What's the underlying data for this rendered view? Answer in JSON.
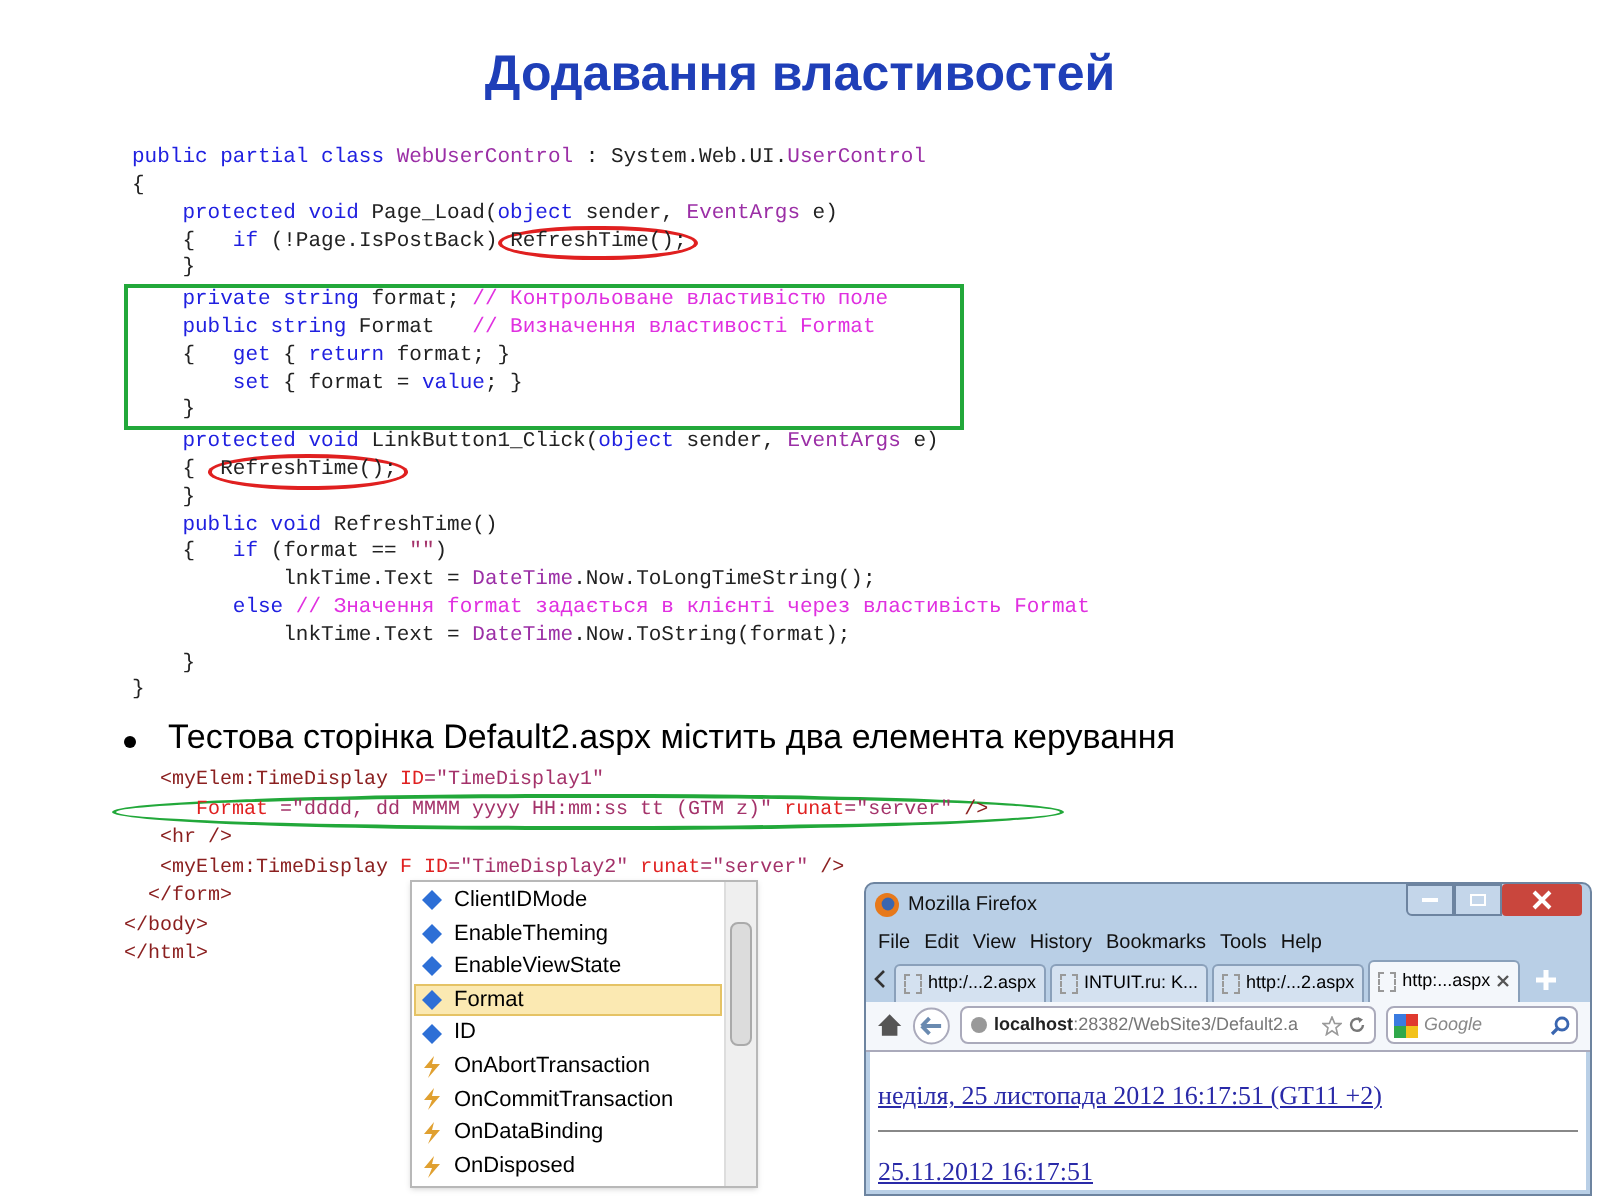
{
  "title": "Додавання властивостей",
  "code_blocks": [
    {
      "boxed": false,
      "lines": [
        [
          {
            "text": "public partial class ",
            "kind": "keyword"
          },
          {
            "text": "WebUserControl",
            "kind": "type"
          },
          {
            "text": " : System.Web.UI.",
            "kind": "plain"
          },
          {
            "text": "UserControl",
            "kind": "type"
          }
        ],
        [
          {
            "text": "{",
            "kind": "plain"
          }
        ],
        [
          {
            "text": "    protected void ",
            "kind": "keyword"
          },
          {
            "text": "Page_Load(",
            "kind": "plain"
          },
          {
            "text": "object",
            "kind": "keyword"
          },
          {
            "text": " sender, ",
            "kind": "plain"
          },
          {
            "text": "EventArgs",
            "kind": "type"
          },
          {
            "text": " e)",
            "kind": "plain"
          }
        ],
        [
          {
            "text": "    {   ",
            "kind": "plain"
          },
          {
            "text": "if",
            "kind": "keyword"
          },
          {
            "text": " (!Page.IsPostBack) ",
            "kind": "plain"
          },
          {
            "text": "RefreshTime();",
            "kind": "circled"
          }
        ],
        [
          {
            "text": "    }",
            "kind": "plain"
          }
        ]
      ]
    },
    {
      "boxed": true,
      "lines": [
        [
          {
            "text": "    private string ",
            "kind": "keyword"
          },
          {
            "text": "format; ",
            "kind": "plain"
          },
          {
            "text": "// Контрольоване властивістю поле",
            "kind": "comment"
          }
        ],
        [
          {
            "text": "    public string ",
            "kind": "keyword"
          },
          {
            "text": "Format   ",
            "kind": "plain"
          },
          {
            "text": "// Визначення властивості Format",
            "kind": "comment"
          }
        ],
        [
          {
            "text": "    {   ",
            "kind": "plain"
          },
          {
            "text": "get",
            "kind": "keyword"
          },
          {
            "text": " { ",
            "kind": "plain"
          },
          {
            "text": "return",
            "kind": "keyword"
          },
          {
            "text": " format; }",
            "kind": "plain"
          }
        ],
        [
          {
            "text": "        set",
            "kind": "keyword"
          },
          {
            "text": " { format = ",
            "kind": "plain"
          },
          {
            "text": "value",
            "kind": "keyword"
          },
          {
            "text": "; }",
            "kind": "plain"
          }
        ],
        [
          {
            "text": "    }",
            "kind": "plain"
          }
        ]
      ]
    },
    {
      "boxed": false,
      "lines": [
        [
          {
            "text": "    protected void ",
            "kind": "keyword"
          },
          {
            "text": "LinkButton1_Click(",
            "kind": "plain"
          },
          {
            "text": "object",
            "kind": "keyword"
          },
          {
            "text": " sender, ",
            "kind": "plain"
          },
          {
            "text": "EventArgs",
            "kind": "type"
          },
          {
            "text": " e)",
            "kind": "plain"
          }
        ],
        [
          {
            "text": "    {  ",
            "kind": "plain"
          },
          {
            "text": "RefreshTime();",
            "kind": "circled"
          }
        ],
        [
          {
            "text": "    }",
            "kind": "plain"
          }
        ],
        [
          {
            "text": "    public void ",
            "kind": "keyword"
          },
          {
            "text": "RefreshTime()",
            "kind": "plain"
          }
        ],
        [
          {
            "text": "    {   ",
            "kind": "plain"
          },
          {
            "text": "if",
            "kind": "keyword"
          },
          {
            "text": " (format == ",
            "kind": "plain"
          },
          {
            "text": "\"\"",
            "kind": "string"
          },
          {
            "text": ")",
            "kind": "plain"
          }
        ],
        [
          {
            "text": "            lnkTime.Text = ",
            "kind": "plain"
          },
          {
            "text": "DateTime",
            "kind": "type"
          },
          {
            "text": ".Now.ToLongTimeString();",
            "kind": "plain"
          }
        ],
        [
          {
            "text": "        else ",
            "kind": "keyword"
          },
          {
            "text": "// Значення format задається в клієнті через властивість Format",
            "kind": "comment"
          }
        ],
        [
          {
            "text": "            lnkTime.Text = ",
            "kind": "plain"
          },
          {
            "text": "DateTime",
            "kind": "type"
          },
          {
            "text": ".Now.ToString(format);",
            "kind": "plain"
          }
        ],
        [
          {
            "text": "    }",
            "kind": "plain"
          }
        ],
        [
          {
            "text": "}",
            "kind": "plain"
          }
        ]
      ]
    }
  ],
  "bullet": "Тестова сторінка Default2.aspx містить два елемента керування",
  "markup_lines": [
    {
      "circled": false,
      "segs": [
        {
          "text": "   <myElem:TimeDisplay ",
          "kind": "tag"
        },
        {
          "text": "ID",
          "kind": "attr"
        },
        {
          "text": "=\"TimeDisplay1\"",
          "kind": "string"
        }
      ]
    },
    {
      "circled": true,
      "segs": [
        {
          "text": "      Format",
          "kind": "attr"
        },
        {
          "text": " =\"dddd, dd MMMM yyyy HH:mm:ss tt (GTM z)\" ",
          "kind": "string"
        },
        {
          "text": "runat",
          "kind": "attr"
        },
        {
          "text": "=\"server\"",
          "kind": "string"
        },
        {
          "text": " />",
          "kind": "tag"
        }
      ]
    },
    {
      "circled": false,
      "segs": [
        {
          "text": "   <hr />",
          "kind": "tag"
        }
      ]
    },
    {
      "circled": false,
      "segs": [
        {
          "text": "   <myElem:TimeDisplay ",
          "kind": "tag"
        },
        {
          "text": "F",
          "kind": "attr"
        },
        {
          "text": " ID",
          "kind": "attr"
        },
        {
          "text": "=\"TimeDisplay2\" ",
          "kind": "string"
        },
        {
          "text": "runat",
          "kind": "attr"
        },
        {
          "text": "=\"server\"",
          "kind": "string"
        },
        {
          "text": " />",
          "kind": "tag"
        }
      ]
    },
    {
      "circled": false,
      "segs": [
        {
          "text": "  </form>",
          "kind": "tag"
        }
      ]
    },
    {
      "circled": false,
      "segs": [
        {
          "text": "</body>",
          "kind": "tag"
        }
      ]
    },
    {
      "circled": false,
      "segs": [
        {
          "text": "</html>",
          "kind": "tag"
        }
      ]
    }
  ],
  "completion": {
    "items": [
      {
        "label": "ClientIDMode",
        "kind": "property",
        "selected": false
      },
      {
        "label": "EnableTheming",
        "kind": "property",
        "selected": false
      },
      {
        "label": "EnableViewState",
        "kind": "property",
        "selected": false
      },
      {
        "label": "Format",
        "kind": "property",
        "selected": true
      },
      {
        "label": "ID",
        "kind": "property",
        "selected": false
      },
      {
        "label": "OnAbortTransaction",
        "kind": "event",
        "selected": false
      },
      {
        "label": "OnCommitTransaction",
        "kind": "event",
        "selected": false
      },
      {
        "label": "OnDataBinding",
        "kind": "event",
        "selected": false
      },
      {
        "label": "OnDisposed",
        "kind": "event",
        "selected": false
      }
    ]
  },
  "browser": {
    "title": "Mozilla Firefox",
    "menu": [
      "File",
      "Edit",
      "View",
      "History",
      "Bookmarks",
      "Tools",
      "Help"
    ],
    "tabs": [
      {
        "label": "http:/...2.aspx",
        "selected": false
      },
      {
        "label": "INTUIT.ru: K...",
        "selected": false
      },
      {
        "label": "http:/...2.aspx",
        "selected": false
      },
      {
        "label": "http:...aspx",
        "selected": true
      }
    ],
    "url_host": "localhost",
    "url_rest": ":28382/WebSite3/Default2.a",
    "search_placeholder": "Google",
    "links": [
      "неділя, 25 листопада 2012 16:17:51 (GT11 +2)",
      "25.11.2012 16:17:51"
    ]
  }
}
